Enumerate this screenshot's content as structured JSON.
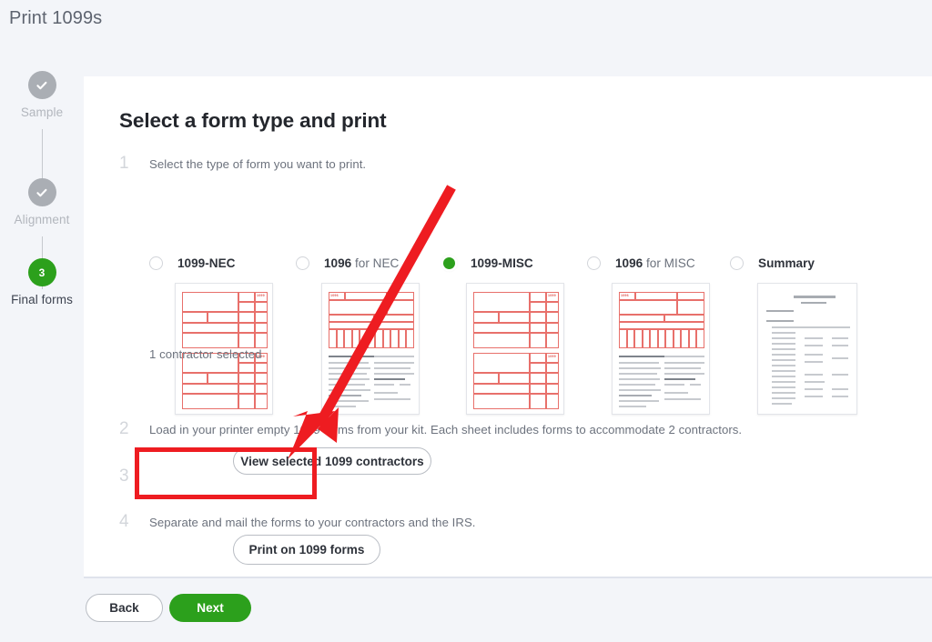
{
  "window": {
    "title": "Print 1099s"
  },
  "stepper": {
    "steps": [
      {
        "label": "Sample",
        "state": "done",
        "icon": "check-icon",
        "num": ""
      },
      {
        "label": "Alignment",
        "state": "done",
        "icon": "check-icon",
        "num": ""
      },
      {
        "label": "Final forms",
        "state": "active",
        "icon": "step-number",
        "num": "3"
      }
    ]
  },
  "card": {
    "heading": "Select a form type and print",
    "steps": [
      {
        "num": "1",
        "text": "Select the type of form you want to print."
      },
      {
        "num": "2",
        "text": "Load in your printer empty 1099 forms from your kit. Each sheet includes forms to accommodate 2 contractors."
      },
      {
        "num": "3",
        "text": ""
      },
      {
        "num": "4",
        "text": "Separate and mail the forms to your contractors and the IRS."
      }
    ],
    "form_options": [
      {
        "label": "1099-NEC",
        "label_bold": "1099-NEC",
        "label_light": "",
        "selected": false,
        "thumb": "nec-form-thumbnail"
      },
      {
        "label": "1096 for NEC",
        "label_bold": "1096",
        "label_light": " for NEC",
        "selected": false,
        "thumb": "1096-nec-form-thumbnail"
      },
      {
        "label": "1099-MISC",
        "label_bold": "1099-MISC",
        "label_light": "",
        "selected": true,
        "thumb": "misc-form-thumbnail"
      },
      {
        "label": "1096 for MISC",
        "label_bold": "1096",
        "label_light": " for MISC",
        "selected": false,
        "thumb": "1096-misc-form-thumbnail"
      },
      {
        "label": "Summary",
        "label_bold": "Summary",
        "label_light": "",
        "selected": false,
        "thumb": "summary-thumbnail"
      }
    ],
    "contractor_status": "1 contractor selected",
    "view_contractors_label": "View selected 1099 contractors",
    "print_forms_label": "Print on 1099 forms"
  },
  "footer": {
    "back_label": "Back",
    "next_label": "Next"
  },
  "colors": {
    "brand_green": "#2ca01c",
    "annotation_red": "#ee1c21",
    "form_red": "#e8706b",
    "page_bg": "#f3f5f9",
    "muted_text": "#6c727d"
  }
}
